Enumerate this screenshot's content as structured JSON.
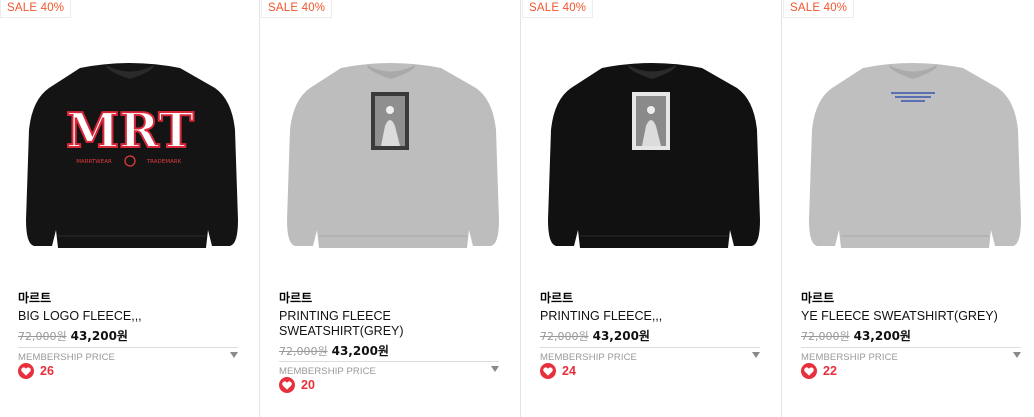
{
  "products": [
    {
      "badge": "SALE 40%",
      "brand": "마르트",
      "name": "BIG LOGO FLEECE,,,",
      "original_price": "72,000원",
      "sale_price": "43,200원",
      "membership_label": "MEMBERSHIP PRICE",
      "likes": "26",
      "image": {
        "garment_color": "#141414",
        "print": "MRT",
        "print_sub_left": "MARRTWEAR",
        "print_sub_right": "TRADEMARK"
      }
    },
    {
      "badge": "SALE 40%",
      "brand": "마르트",
      "name": "PRINTING FLEECE SWEATSHIRT(GREY)",
      "original_price": "72,000원",
      "sale_price": "43,200원",
      "membership_label": "MEMBERSHIP PRICE",
      "likes": "20",
      "image": {
        "garment_color": "#bdbdbd"
      }
    },
    {
      "badge": "SALE 40%",
      "brand": "마르트",
      "name": "PRINTING FLEECE,,,",
      "original_price": "72,000원",
      "sale_price": "43,200원",
      "membership_label": "MEMBERSHIP PRICE",
      "likes": "24",
      "image": {
        "garment_color": "#111111"
      }
    },
    {
      "badge": "SALE 40%",
      "brand": "마르트",
      "name": "YE FLEECE SWEATSHIRT(GREY)",
      "original_price": "72,000원",
      "sale_price": "43,200원",
      "membership_label": "MEMBERSHIP PRICE",
      "likes": "22",
      "image": {
        "garment_color": "#bfbfbf"
      }
    }
  ],
  "colors": {
    "accent": "#f2552c",
    "heart": "#e8303c",
    "muted": "#9a9a9a"
  },
  "icons": {
    "like": "heart-icon",
    "membership_toggle": "caret-down-icon"
  }
}
